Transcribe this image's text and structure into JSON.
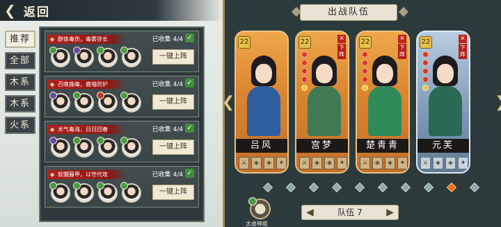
{
  "header": {
    "back_label": "返回"
  },
  "tabs": [
    {
      "label": "推荐",
      "active": true
    },
    {
      "label": "全部",
      "active": false
    },
    {
      "label": "木系",
      "active": false
    },
    {
      "label": "木系",
      "active": false
    },
    {
      "label": "火系",
      "active": false
    }
  ],
  "records": [
    {
      "title": "群体毒伤，毒雾弥长",
      "collected": "已收集 4/4",
      "button": "一键上阵",
      "elements": [
        "g",
        "p",
        "g",
        "g"
      ]
    },
    {
      "title": "召唤施毒，鹿墙防护",
      "collected": "已收集 4/4",
      "button": "一键上阵",
      "elements": [
        "p",
        "g",
        "r",
        "g"
      ]
    },
    {
      "title": "木气毒海，日日回春",
      "collected": "已收集 4/4",
      "button": "一键上阵",
      "elements": [
        "p",
        "g",
        "g",
        "g"
      ]
    },
    {
      "title": "软猬藤甲，以守代攻",
      "collected": "已收集 4/4",
      "button": "一键上阵",
      "elements": [
        "g",
        "g",
        "g",
        "g"
      ]
    }
  ],
  "team": {
    "title": "出战队伍",
    "switch_label": "队伍 7",
    "skill_label": "太虚神庭",
    "remove_label": "下阵",
    "pages": 10,
    "active_page": 8,
    "members": [
      {
        "name": "吕风",
        "level": "22",
        "stars": 0,
        "gold_stars": 0,
        "theme": "orange",
        "removable": false,
        "body_color": "#2e5f9c"
      },
      {
        "name": "宫梦",
        "level": "22",
        "stars": 4,
        "gold_stars": 1,
        "theme": "orange",
        "removable": true,
        "body_color": "#3f7a55"
      },
      {
        "name": "楚青青",
        "level": "22",
        "stars": 4,
        "gold_stars": 1,
        "theme": "orange",
        "removable": true,
        "body_color": "#2f8a5a"
      },
      {
        "name": "元芙",
        "level": "22",
        "stars": 4,
        "gold_stars": 1,
        "theme": "blue",
        "removable": true,
        "body_color": "#2a6a52"
      }
    ]
  },
  "colors": {
    "accent_red": "#b3201c",
    "panel": "#2e393b",
    "gold": "#e9c14a",
    "active_page": "#e6701e"
  }
}
